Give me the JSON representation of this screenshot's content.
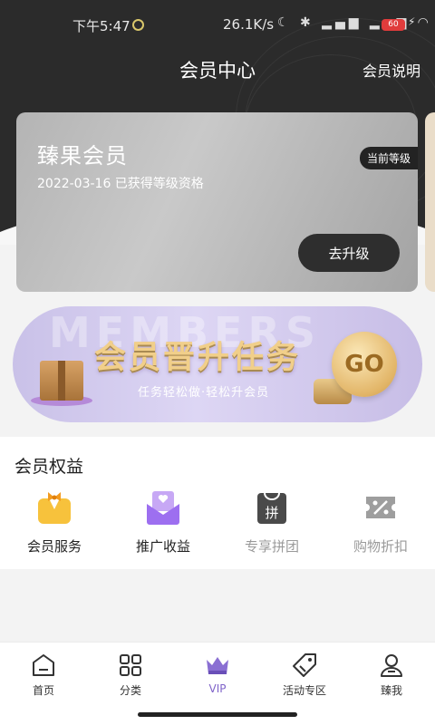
{
  "status_bar": {
    "time": "下午5:47",
    "network_speed": "26.1K/s",
    "battery": "60"
  },
  "header": {
    "title": "会员中心",
    "help_link": "会员说明"
  },
  "member_card": {
    "level_name": "臻果会员",
    "qualified_text": "2022-03-16 已获得等级资格",
    "current_badge": "当前等级",
    "upgrade_button": "去升级"
  },
  "task_banner": {
    "watermark": "MEMBERS",
    "title": "会员晋升任务",
    "subtitle": "任务轻松做·轻松升会员",
    "go_label": "GO"
  },
  "benefits": {
    "title": "会员权益",
    "items": [
      {
        "label": "会员服务",
        "icon": "member-service-icon",
        "active": true
      },
      {
        "label": "推广收益",
        "icon": "promotion-income-icon",
        "active": true
      },
      {
        "label": "专享拼团",
        "icon": "group-buy-icon",
        "active": false
      },
      {
        "label": "购物折扣",
        "icon": "discount-coupon-icon",
        "active": false
      }
    ]
  },
  "bottom_nav": {
    "items": [
      {
        "label": "首页",
        "icon": "home-icon"
      },
      {
        "label": "分类",
        "icon": "category-grid-icon"
      },
      {
        "label": "VIP",
        "icon": "crown-icon"
      },
      {
        "label": "活动专区",
        "icon": "tag-icon"
      },
      {
        "label": "臻我",
        "icon": "profile-icon"
      }
    ],
    "active_index": 2
  },
  "colors": {
    "header_bg": "#2b2b2b",
    "accent_purple": "#7f63c9",
    "gold": "#f1cf8a"
  }
}
